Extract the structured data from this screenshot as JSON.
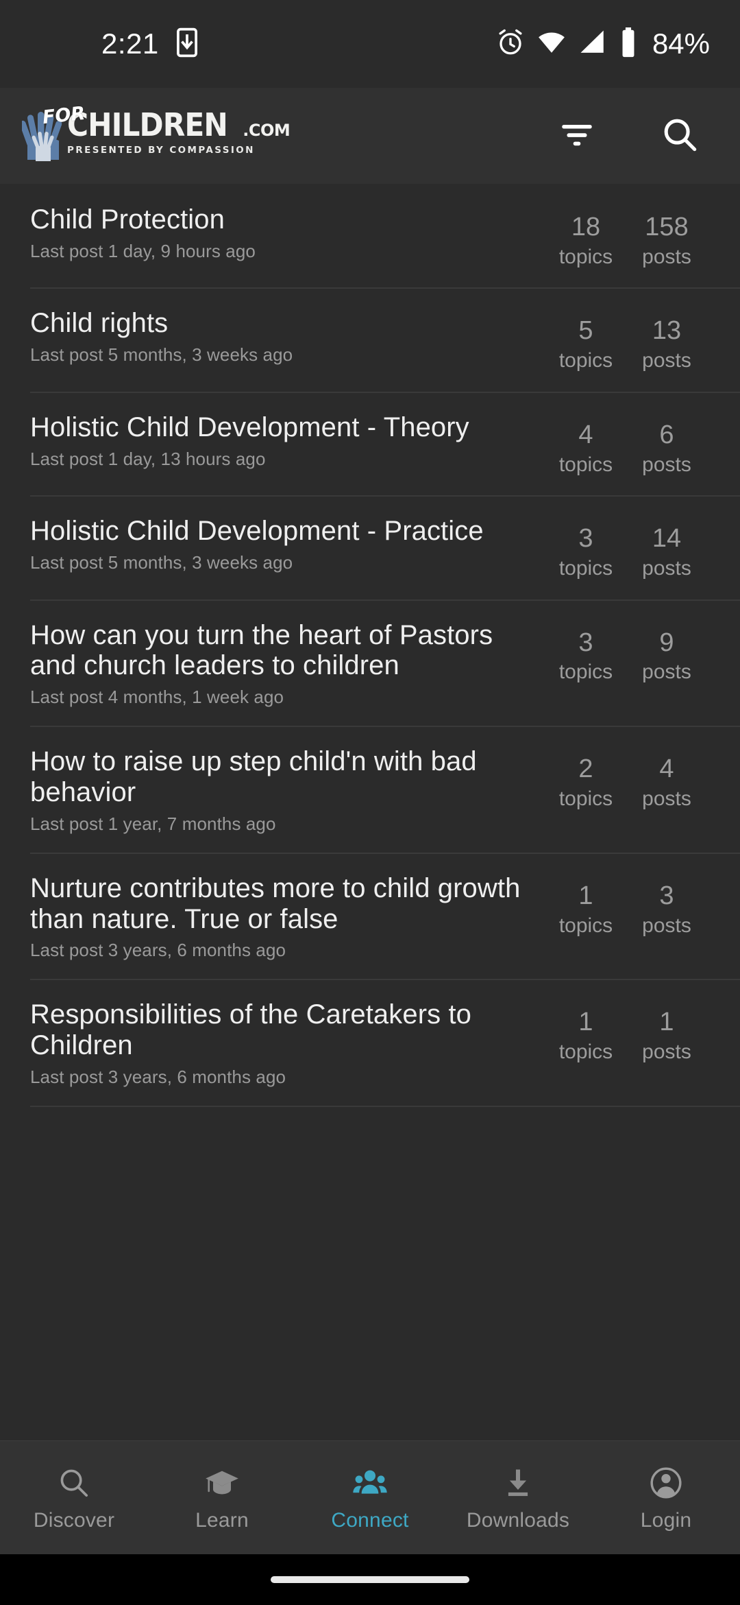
{
  "status_bar": {
    "time": "2:21",
    "battery_percent": "84%",
    "icons": [
      "download-app-icon",
      "alarm-icon",
      "wifi-icon",
      "cellular-signal-icon",
      "battery-icon"
    ]
  },
  "app_bar": {
    "logo": {
      "for": "FOR",
      "name": "CHILDREN",
      "tld": ".COM",
      "tagline": "PRESENTED BY COMPASSION"
    },
    "filter_icon": "filter-icon",
    "search_icon": "search-icon"
  },
  "forum": {
    "stat_labels": {
      "topics": "topics",
      "posts": "posts"
    },
    "rows": [
      {
        "title": "Child Protection",
        "last_post": "Last post 1 day, 9 hours ago",
        "topics": "18",
        "posts": "158"
      },
      {
        "title": "Child rights",
        "last_post": "Last post 5 months, 3 weeks ago",
        "topics": "5",
        "posts": "13"
      },
      {
        "title": "Holistic Child Development - Theory",
        "last_post": "Last post 1 day, 13 hours ago",
        "topics": "4",
        "posts": "6"
      },
      {
        "title": "Holistic Child Development - Practice",
        "last_post": "Last post 5 months, 3 weeks ago",
        "topics": "3",
        "posts": "14"
      },
      {
        "title": "How can you turn the heart of Pastors and church leaders to children",
        "last_post": "Last post 4 months, 1 week ago",
        "topics": "3",
        "posts": "9"
      },
      {
        "title": "How to raise up step child'n with bad behavior",
        "last_post": "Last post 1 year, 7 months ago",
        "topics": "2",
        "posts": "4"
      },
      {
        "title": "Nurture contributes more to child growth than nature. True or false",
        "last_post": "Last post 3 years, 6 months ago",
        "topics": "1",
        "posts": "3"
      },
      {
        "title": "Responsibilities of the Caretakers to Children",
        "last_post": "Last post 3 years, 6 months ago",
        "topics": "1",
        "posts": "1"
      }
    ]
  },
  "bottom_nav": {
    "active": "Connect",
    "items": [
      {
        "label": "Discover",
        "icon": "search-icon"
      },
      {
        "label": "Learn",
        "icon": "graduation-cap-icon"
      },
      {
        "label": "Connect",
        "icon": "people-group-icon"
      },
      {
        "label": "Downloads",
        "icon": "download-icon"
      },
      {
        "label": "Login",
        "icon": "account-circle-icon"
      }
    ]
  },
  "colors": {
    "accent": "#3ea8c4",
    "background": "#2b2b2b",
    "app_bar_background": "#313131",
    "nav_background": "#333333",
    "title_text": "#efefef",
    "muted_text": "#9a9a9a",
    "divider": "#3a3a3a"
  }
}
